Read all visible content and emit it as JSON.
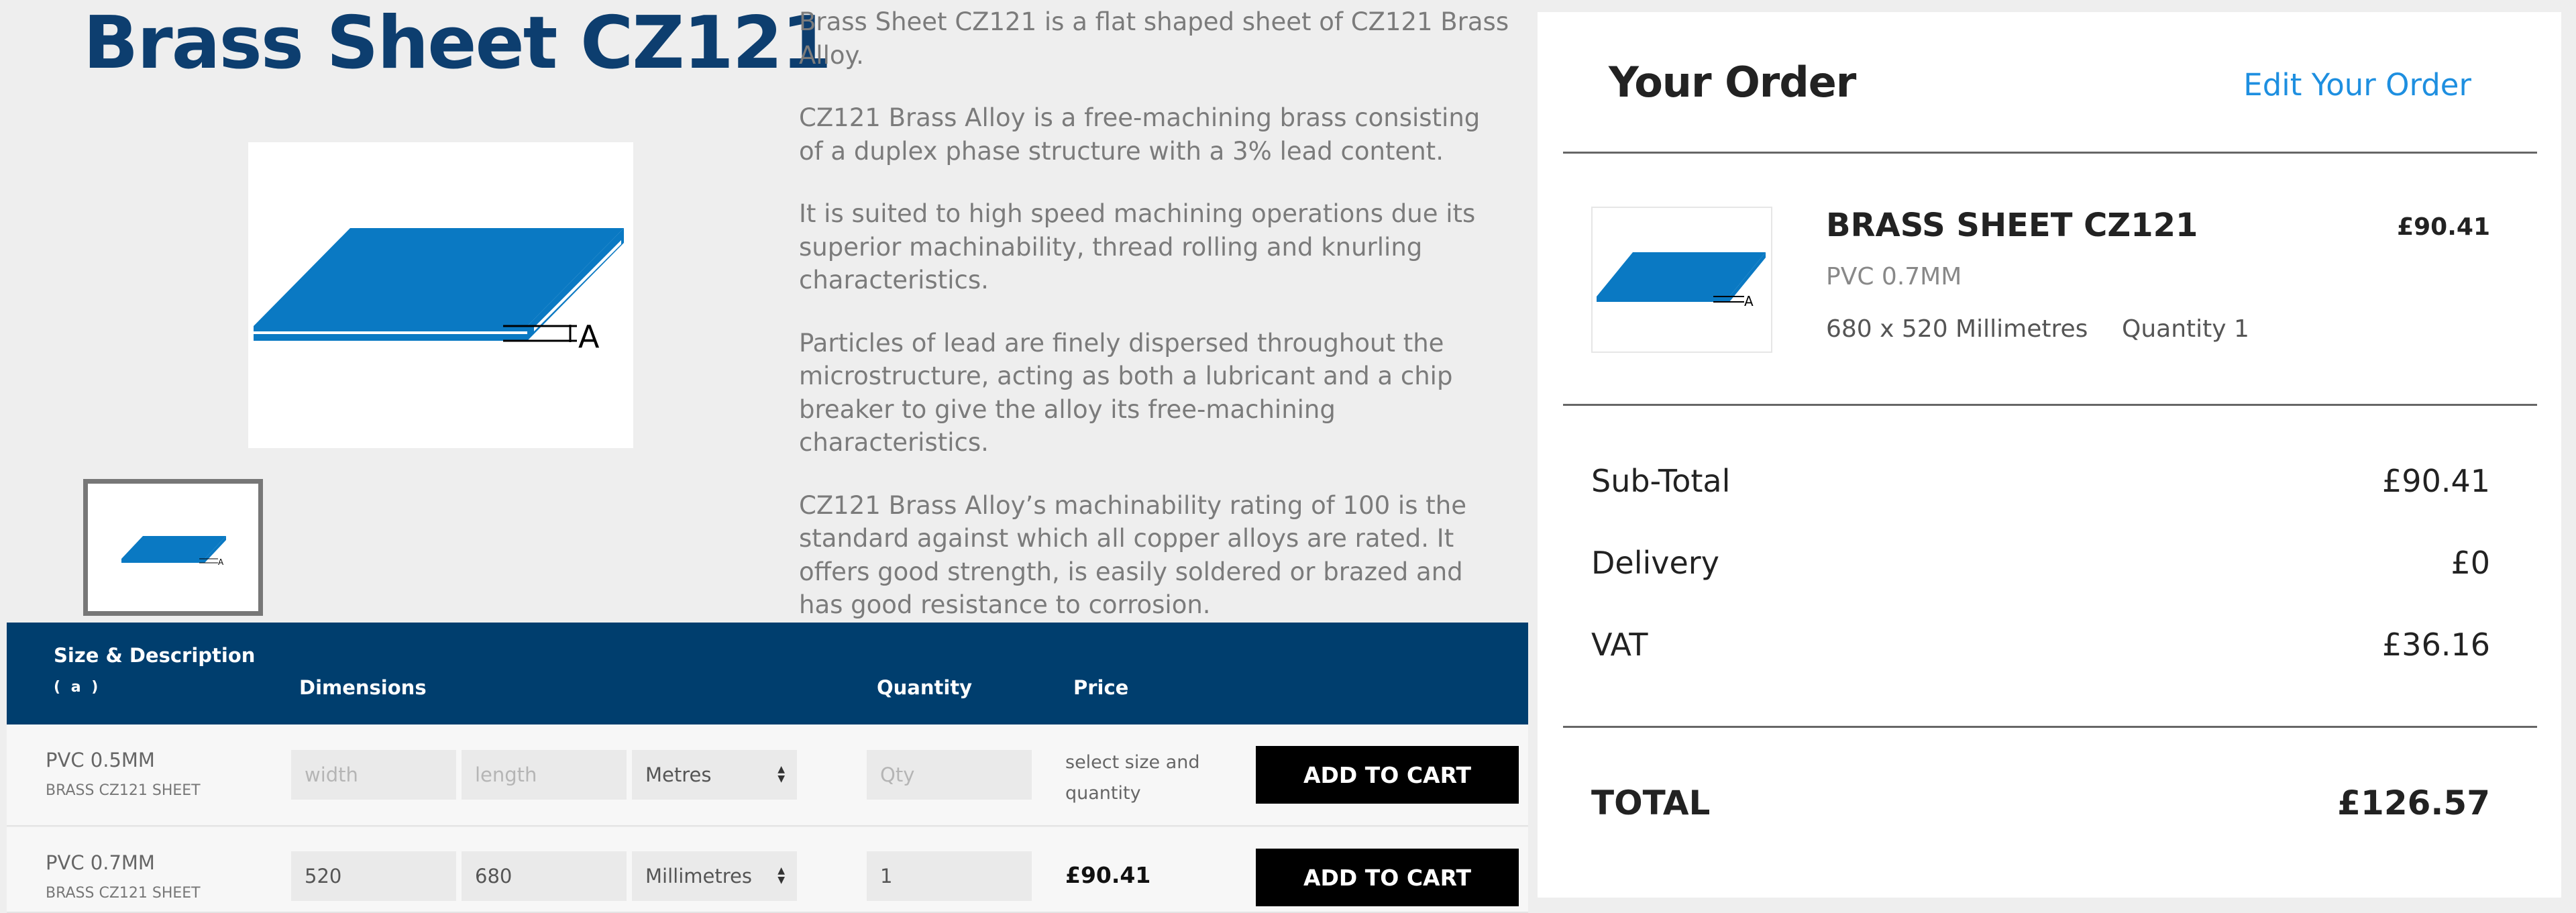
{
  "product": {
    "title": "Brass Sheet CZ121",
    "image_icon": "sheet-dimension-diagram-icon",
    "diagram_label": "A"
  },
  "description": [
    "Brass Sheet CZ121 is a flat shaped sheet of CZ121 Brass Alloy.",
    "CZ121 Brass Alloy is a free-machining brass consisting of a duplex phase structure with a 3% lead content.",
    "It is suited to high speed machining operations due its superior machinability, thread rolling and knurling characteristics.",
    "Particles of lead are finely dispersed throughout the microstructure, acting as both a lubricant and a chip breaker to give the alloy its free-machining characteristics.",
    "CZ121 Brass Alloy’s machinability rating of 100 is the standard against which all copper alloys are rated. It offers good strength, is easily soldered or brazed and has good resistance to corrosion."
  ],
  "table": {
    "headers": {
      "size": "Size & Description",
      "size_sub": "( a )",
      "dimensions": "Dimensions",
      "quantity": "Quantity",
      "price": "Price"
    },
    "rows": [
      {
        "name": "PVC 0.5MM",
        "sub": "BRASS CZ121 SHEET",
        "width_value": "",
        "width_placeholder": "width",
        "length_value": "",
        "length_placeholder": "length",
        "unit": "Metres",
        "qty_value": "",
        "qty_placeholder": "Qty",
        "price_note": "select size and quantity",
        "button": "ADD TO CART"
      },
      {
        "name": "PVC 0.7MM",
        "sub": "BRASS CZ121 SHEET",
        "width_value": "520",
        "length_value": "680",
        "unit": "Millimetres",
        "qty_value": "1",
        "price": "£90.41",
        "button": "ADD TO CART"
      }
    ]
  },
  "order": {
    "title": "Your Order",
    "edit_link": "Edit Your Order",
    "item": {
      "name": "BRASS SHEET CZ121",
      "price": "£90.41",
      "variant": "PVC 0.7MM",
      "dimensions": "680 x 520 Millimetres",
      "quantity": "Quantity 1"
    },
    "summary": {
      "subtotal_label": "Sub-Total",
      "subtotal": "£90.41",
      "delivery_label": "Delivery",
      "delivery": "£0",
      "vat_label": "VAT",
      "vat": "£36.16",
      "total_label": "TOTAL",
      "total": "£126.57"
    }
  },
  "colors": {
    "title_blue": "#0d3e6f",
    "header_navy": "#003e6e",
    "sheet_blue": "#0a79c3",
    "link_blue": "#1e8fe0",
    "button_black": "#000000"
  }
}
